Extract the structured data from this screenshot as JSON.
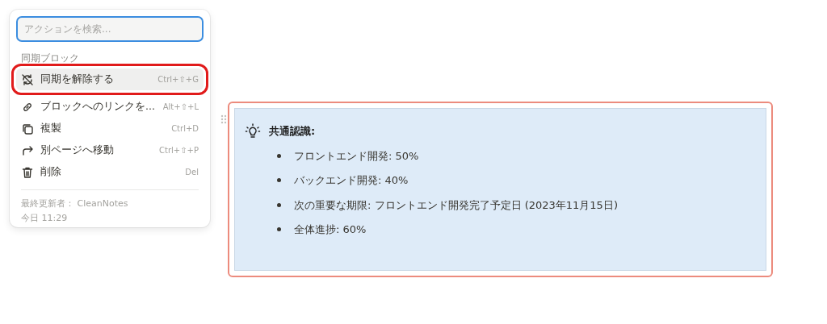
{
  "menu": {
    "search": {
      "placeholder": "アクションを検索..."
    },
    "section_label": "同期ブロック",
    "items": [
      {
        "kind": "unsync",
        "label": "同期を解除する",
        "shortcut": "Ctrl+⇧+G",
        "selected": true,
        "highlighted": true
      },
      {
        "kind": "link",
        "label": "ブロックへのリンクを...",
        "shortcut": "Alt+⇧+L",
        "selected": false,
        "highlighted": false
      },
      {
        "kind": "duplicate",
        "label": "複製",
        "shortcut": "Ctrl+D",
        "selected": false,
        "highlighted": false
      },
      {
        "kind": "move",
        "label": "別ページへ移動",
        "shortcut": "Ctrl+⇧+P",
        "selected": false,
        "highlighted": false
      },
      {
        "kind": "delete",
        "label": "削除",
        "shortcut": "Del",
        "selected": false,
        "highlighted": false
      }
    ],
    "footer": [
      "最終更新者： CleanNotes",
      "今日 11:29"
    ]
  },
  "callout": {
    "title": "共通認識:",
    "bullets": [
      "フロントエンド開発: 50%",
      "バックエンド開発: 40%",
      "次の重要な期限: フロントエンド開発完了予定日 (2023年11月15日)",
      "全体進捗: 60%"
    ]
  }
}
